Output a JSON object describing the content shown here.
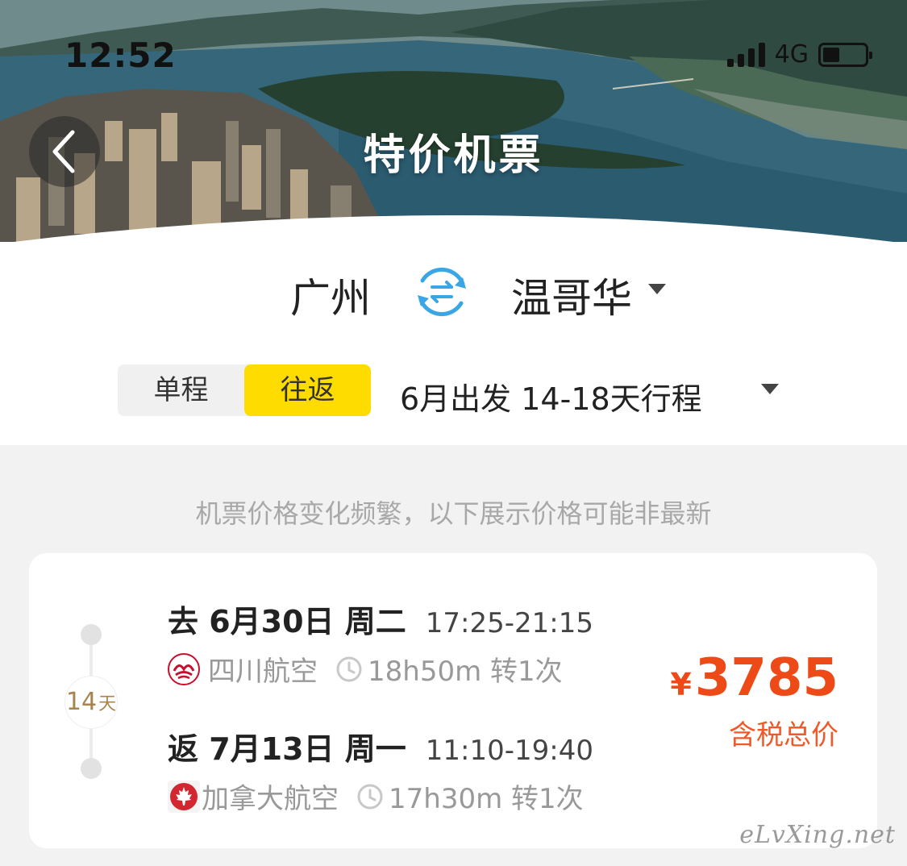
{
  "status_bar": {
    "time": "12:52",
    "network": "4G"
  },
  "header": {
    "title": "特价机票",
    "back_icon": "chevron-left-icon"
  },
  "route": {
    "from": "广州",
    "to": "温哥华",
    "swap_icon": "swap-icon",
    "accent": "#3aa6e6"
  },
  "trip": {
    "one_way_label": "单程",
    "round_trip_label": "往返",
    "selected": "往返",
    "description": "6月出发 14-18天行程",
    "accent": "#ffdc00"
  },
  "notice": "机票价格变化频繁，以下展示价格可能非最新",
  "offer": {
    "days": "14",
    "days_unit": "天",
    "outbound": {
      "title": "去 6月30日 周二",
      "time": "17:25-21:15",
      "airline": "四川航空",
      "duration": "18h50m 转1次"
    },
    "return": {
      "title": "返 7月13日 周一",
      "time": "11:10-19:40",
      "airline": "加拿大航空",
      "duration": "17h30m 转1次"
    },
    "currency": "¥",
    "price": "3785",
    "price_note": "含税总价",
    "price_color": "#ee4a17"
  },
  "watermark": "eLvXing.net"
}
